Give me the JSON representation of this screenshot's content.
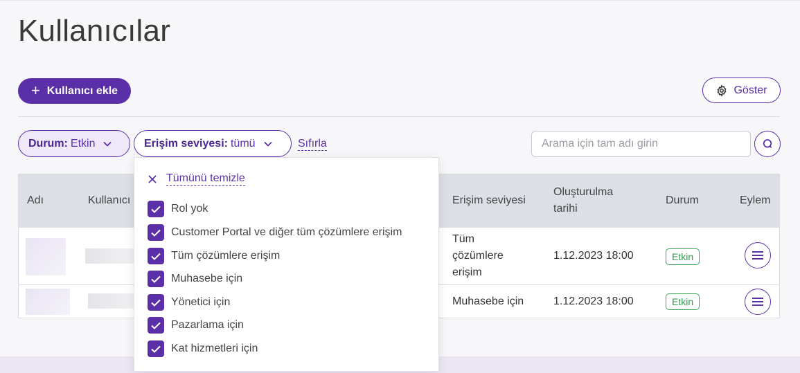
{
  "page": {
    "title": "Kullanıcılar"
  },
  "toolbar": {
    "add_user_label": "Kullanıcı ekle",
    "show_label": "Göster"
  },
  "filters": {
    "status": {
      "label": "Durum:",
      "value": "Etkin"
    },
    "access": {
      "label": "Erişim seviyesi:",
      "value": "tümü"
    },
    "reset_label": "Sıfırla"
  },
  "search": {
    "placeholder": "Arama için tam adı girin"
  },
  "table": {
    "columns": [
      "Adı",
      "Kullanıcı",
      "Erişim seviyesi",
      "Oluşturulma tarihi",
      "Durum",
      "Eylem"
    ],
    "rows": [
      {
        "access": "Tüm çözümlere erişim",
        "created": "1.12.2023 18:00",
        "status": "Etkin"
      },
      {
        "access": "Muhasebe için",
        "created": "1.12.2023 18:00",
        "status": "Etkin"
      }
    ]
  },
  "dropdown": {
    "clear_all_label": "Tümünü temizle",
    "options": [
      {
        "label": "Rol yok",
        "checked": true
      },
      {
        "label": "Customer Portal ve diğer tüm çözümlere erişim",
        "checked": true
      },
      {
        "label": "Tüm çözümlere erişim",
        "checked": true
      },
      {
        "label": "Muhasebe için",
        "checked": true
      },
      {
        "label": "Yönetici için",
        "checked": true
      },
      {
        "label": "Pazarlama için",
        "checked": true
      },
      {
        "label": "Kat hizmetleri için",
        "checked": true
      }
    ]
  },
  "colors": {
    "accent": "#5b2fa8",
    "success": "#2f9a49",
    "header_bg": "#dcdfe5"
  },
  "icons": [
    "plus-icon",
    "gear-icon",
    "chevron-down-icon",
    "search-icon",
    "close-icon",
    "check-icon",
    "menu-icon"
  ]
}
